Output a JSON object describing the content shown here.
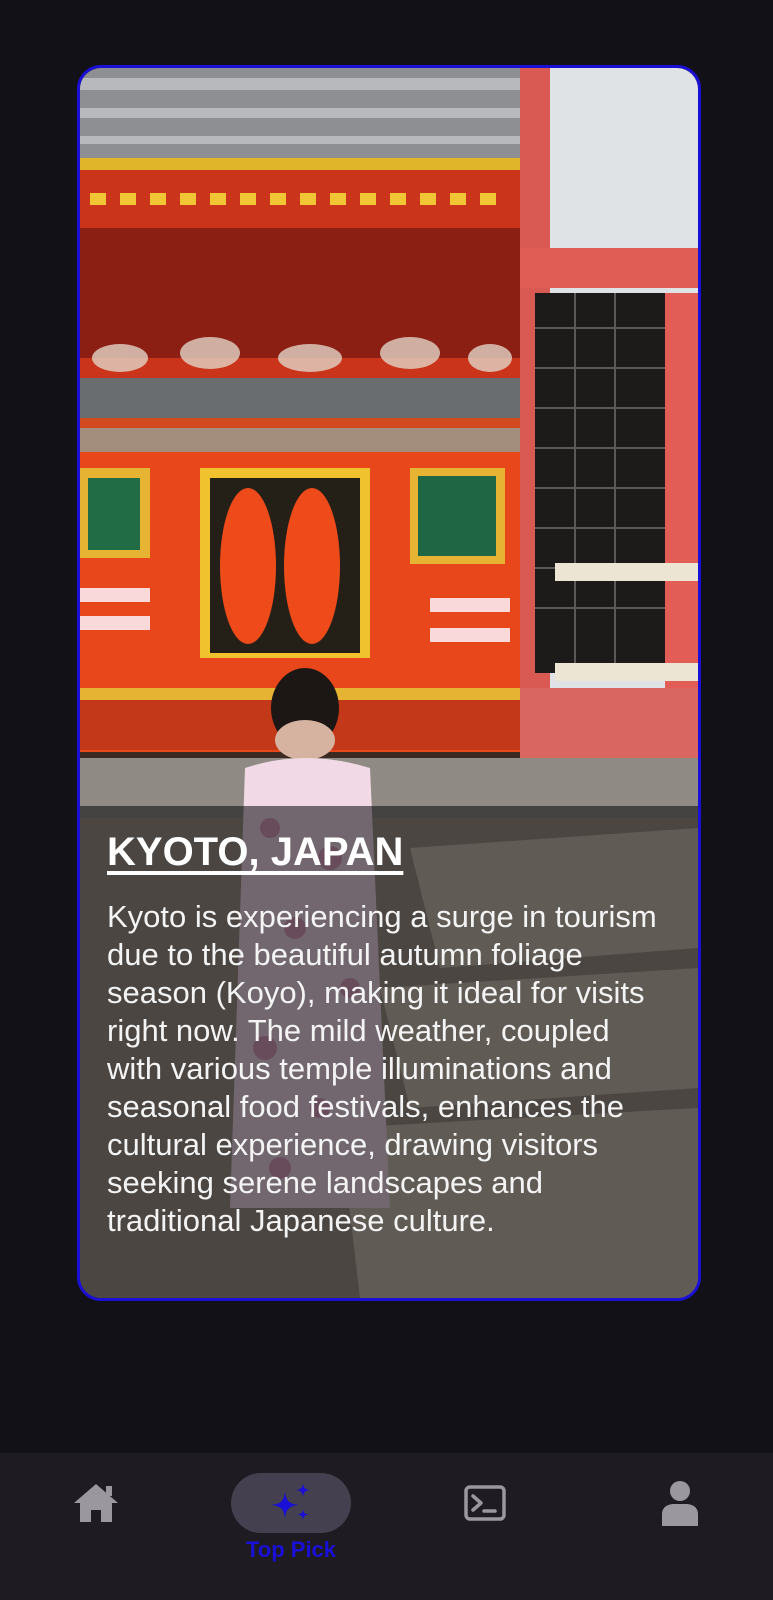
{
  "card": {
    "title": "KYOTO, JAPAN",
    "description": "Kyoto is experiencing a surge in tourism due to the beautiful autumn foliage season (Koyo), making it ideal for visits right now. The mild weather, coupled with various temple illuminations and seasonal food festivals, enhances the cultural experience, drawing visitors seeking serene landscapes and traditional Japanese culture.",
    "border_color": "#1a0fd6"
  },
  "nav": {
    "items": [
      {
        "icon": "home-icon",
        "label": ""
      },
      {
        "icon": "sparkle-icon",
        "label": "Top Pick"
      },
      {
        "icon": "terminal-icon",
        "label": ""
      },
      {
        "icon": "person-icon",
        "label": ""
      }
    ],
    "active_index": 1,
    "active_color": "#1a0fd6",
    "inactive_color": "#9a989e"
  }
}
